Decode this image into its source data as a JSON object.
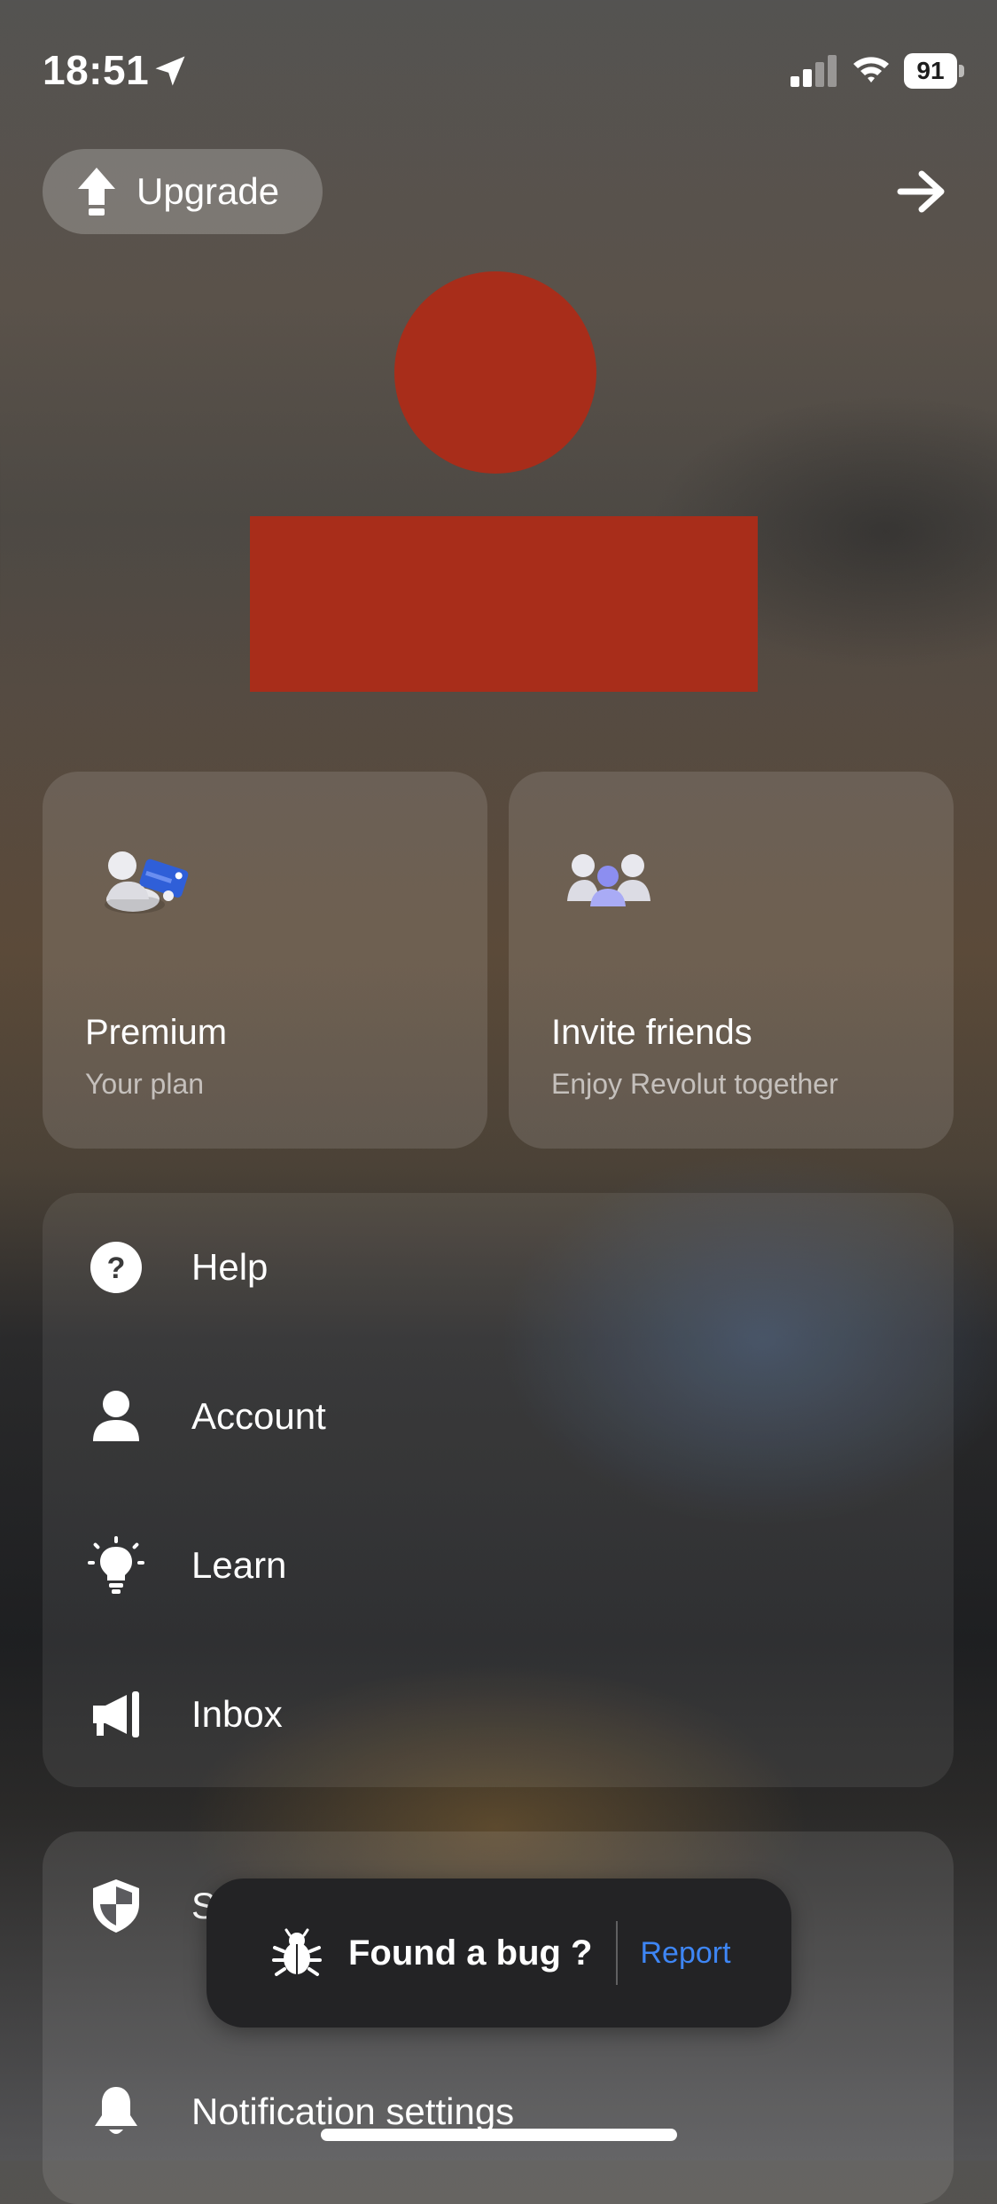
{
  "status_bar": {
    "time": "18:51",
    "battery": "91"
  },
  "header": {
    "upgrade_label": "Upgrade"
  },
  "cards": [
    {
      "title": "Premium",
      "subtitle": "Your plan"
    },
    {
      "title": "Invite friends",
      "subtitle": "Enjoy Revolut together"
    }
  ],
  "menu": {
    "items": [
      {
        "label": "Help",
        "icon": "help-icon"
      },
      {
        "label": "Account",
        "icon": "person-icon"
      },
      {
        "label": "Learn",
        "icon": "lightbulb-icon"
      },
      {
        "label": "Inbox",
        "icon": "megaphone-icon"
      }
    ]
  },
  "menu2": {
    "items": [
      {
        "label": "S",
        "icon": "shield-icon"
      },
      {
        "label": "Notification settings",
        "icon": "bell-icon"
      }
    ]
  },
  "toast": {
    "text": "Found a bug ?",
    "action": "Report"
  },
  "colors": {
    "redaction": "#a82d1a",
    "link": "#3e86f5"
  }
}
